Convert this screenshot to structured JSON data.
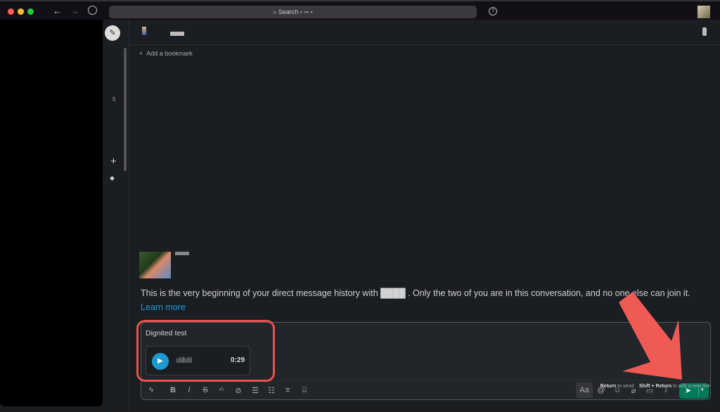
{
  "topbar": {
    "search_placeholder": "Search"
  },
  "rail": {
    "badge": "5"
  },
  "channel": {
    "add_bookmark": "Add a bookmark"
  },
  "intro": {
    "text": "This is the very beginning of your direct message history with ████ . Only the two of you are in this conversation, and no one else can join it.",
    "learn_more": "Learn more"
  },
  "composer": {
    "message": "Dignited test",
    "audio_duration": "0:29"
  },
  "hints": {
    "return_key": "Return",
    "return_action": "to send",
    "shift_key": "Shift + Return",
    "shift_action": "to add a new line"
  },
  "colors": {
    "accent": "#1d9bd1",
    "send": "#007a5a",
    "annotation": "#e8534f"
  }
}
